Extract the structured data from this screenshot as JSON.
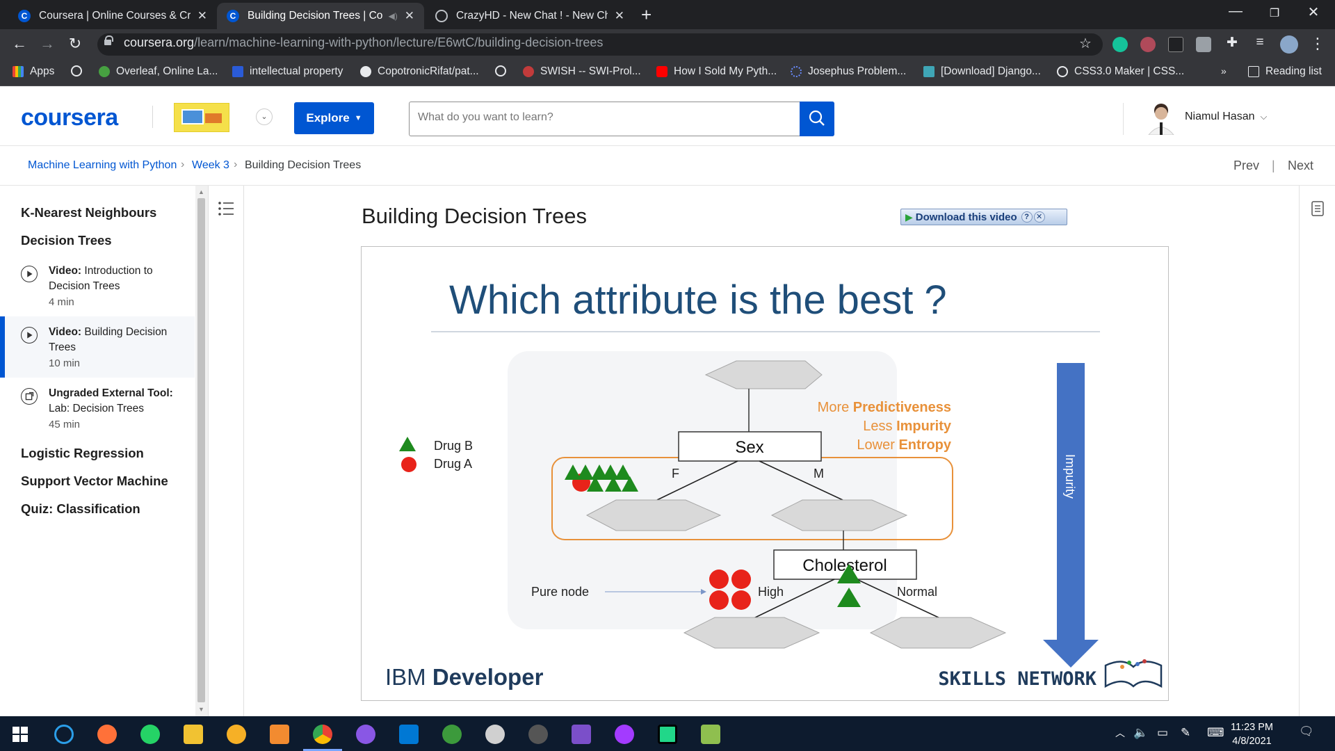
{
  "browser": {
    "tabs": [
      {
        "title": "Coursera | Online Courses & Cre",
        "active": false
      },
      {
        "title": "Building Decision Trees | Cou",
        "active": true
      },
      {
        "title": "CrazyHD - New Chat ! - New Cha",
        "active": false
      }
    ],
    "url_domain": "coursera.org",
    "url_path": "/learn/machine-learning-with-python/lecture/E6wtC/building-decision-trees",
    "bookmarks": [
      {
        "label": "Apps"
      },
      {
        "label": ""
      },
      {
        "label": "Overleaf, Online La..."
      },
      {
        "label": "intellectual property"
      },
      {
        "label": "CopotronicRifat/pat..."
      },
      {
        "label": ""
      },
      {
        "label": "SWISH -- SWI-Prol..."
      },
      {
        "label": "How I Sold My Pyth..."
      },
      {
        "label": "Josephus Problem..."
      },
      {
        "label": "[Download] Django..."
      },
      {
        "label": "CSS3.0 Maker | CSS..."
      },
      {
        "label": "Reading list"
      }
    ]
  },
  "header": {
    "logo": "coursera",
    "explore_label": "Explore",
    "search_placeholder": "What do you want to learn?",
    "user_name": "Niamul Hasan"
  },
  "breadcrumb": {
    "course": "Machine Learning with Python",
    "week": "Week 3",
    "current": "Building Decision Trees",
    "prev": "Prev",
    "next": "Next",
    "sep": "|"
  },
  "outline": {
    "sections_top": [
      "K-Nearest Neighbours",
      "Decision Trees"
    ],
    "lessons": [
      {
        "type": "Video:",
        "title": "Introduction to Decision Trees",
        "duration": "4 min"
      },
      {
        "type": "Video:",
        "title": "Building Decision Trees",
        "duration": "10 min"
      },
      {
        "type": "Ungraded External Tool:",
        "title": "Lab: Decision Trees",
        "duration": "45 min"
      }
    ],
    "sections_bottom": [
      "Logistic Regression",
      "Support Vector Machine",
      "Quiz: Classification"
    ]
  },
  "main": {
    "title": "Building Decision Trees",
    "download_label": "Download this video"
  },
  "slide": {
    "title": "Which attribute is the best ?",
    "legend": [
      "Drug B",
      "Drug A"
    ],
    "predictive_lines": [
      {
        "pre": "More ",
        "bold": "Predictiveness"
      },
      {
        "pre": "Less ",
        "bold": "Impurity"
      },
      {
        "pre": "Lower ",
        "bold": "Entropy"
      }
    ],
    "node_sex": "Sex",
    "branch_f": "F",
    "branch_m": "M",
    "node_cholesterol": "Cholesterol",
    "branch_high": "High",
    "branch_normal": "Normal",
    "pure_node": "Pure node",
    "impurity": "Impurity",
    "ibm_light": "IBM ",
    "ibm_bold": "Developer",
    "skills": "SKILLS NETWORK"
  },
  "taskbar": {
    "time": "11:23 PM",
    "date": "4/8/2021"
  },
  "colors": {
    "coursera_blue": "#0056d2",
    "slide_title": "#1f4e79",
    "orange": "#e8913a",
    "green": "#1e8a1e",
    "red": "#e8231a",
    "arrow_blue": "#4472c4"
  }
}
